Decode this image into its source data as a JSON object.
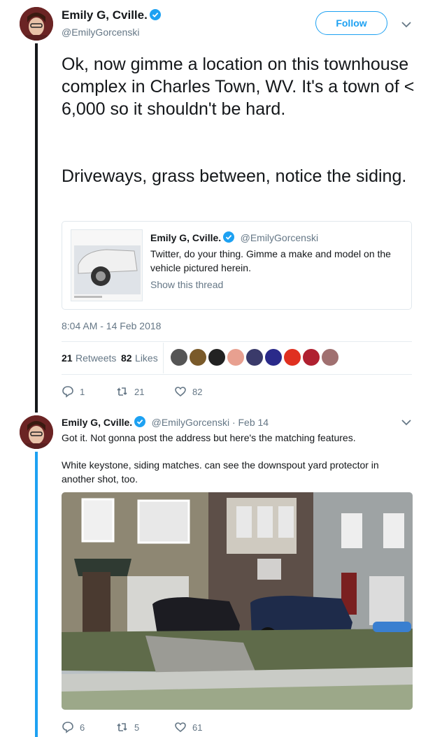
{
  "tweet": {
    "author_name": "Emily G, Cville.",
    "author_handle": "@EmilyGorcenski",
    "follow_label": "Follow",
    "text_p1": "Ok, now gimme a location on this townhouse complex in Charles Town, WV. It's a town of < 6,000 so it shouldn't be hard.",
    "text_p2": "Driveways, grass between, notice the siding.",
    "timestamp": "8:04 AM - 14 Feb 2018",
    "retweets_count": "21",
    "retweets_label": "Retweets",
    "likes_count": "82",
    "likes_label": "Likes",
    "actions": {
      "replies": "1",
      "retweets": "21",
      "likes": "82"
    }
  },
  "quoted": {
    "name": "Emily G, Cville.",
    "handle": "@EmilyGorcenski",
    "text": "Twitter, do your thing. Gimme a make and model on the vehicle pictured herein.",
    "show_thread": "Show this thread"
  },
  "reply": {
    "name": "Emily G, Cville.",
    "handle_date": "@EmilyGorcenski · Feb 14",
    "text_p1": "Got it. Not gonna post the address but here's the matching features.",
    "text_p2": "White keystone, siding matches. can see the downspout yard protector in another shot, too.",
    "actions": {
      "replies": "6",
      "retweets": "5",
      "likes": "61"
    }
  },
  "colors": {
    "accent": "#1da1f2",
    "text": "#14171a",
    "muted": "#657786",
    "like": "#e0245e"
  }
}
